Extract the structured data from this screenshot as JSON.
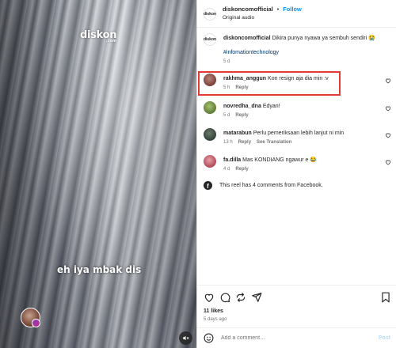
{
  "video": {
    "watermark": "diskon",
    "watermark_sub": ".com",
    "caption": "eh iya mbak dis",
    "mute_icon": "speaker-muted-icon"
  },
  "header": {
    "avatar_text": "diskon",
    "username": "diskoncomofficial",
    "separator": "•",
    "follow_label": "Follow",
    "subtitle": "Original audio"
  },
  "caption_post": {
    "avatar_text": "diskon",
    "username": "diskoncomofficial",
    "text": "Dikira punya nyawa ya sembuh sendiri 😭",
    "hashtag": "#infomationtechnology",
    "age": "5 d"
  },
  "comments": [
    {
      "username": "rakhma_anggun",
      "text": "Kon resign aja dia min :v",
      "age": "5 h",
      "reply": "Reply",
      "avatar_color": "#8a4b45"
    },
    {
      "username": "novredha_dna",
      "text": "Edyan!",
      "age": "5 d",
      "reply": "Reply",
      "avatar_color": "#7a9a4a"
    },
    {
      "username": "matarabun",
      "text": "Perlu pemeriksaan lebih lanjut ni min",
      "age": "13 h",
      "reply": "Reply",
      "translation": "See Translation",
      "avatar_color": "#3a4a3a"
    },
    {
      "username": "fa.dilla",
      "text": "Mas KONDIANG ngawur e 😂",
      "age": "4 d",
      "reply": "Reply",
      "avatar_color": "#c95a6a"
    }
  ],
  "facebook_note": "This reel has 4 comments from Facebook.",
  "actions": {
    "likes": "11 likes",
    "posted": "5 days ago"
  },
  "add_comment": {
    "placeholder": "Add a comment…",
    "post_label": "Post"
  },
  "colors": {
    "accent": "#0095f6",
    "highlight": "#e53935",
    "muted": "#737373"
  }
}
